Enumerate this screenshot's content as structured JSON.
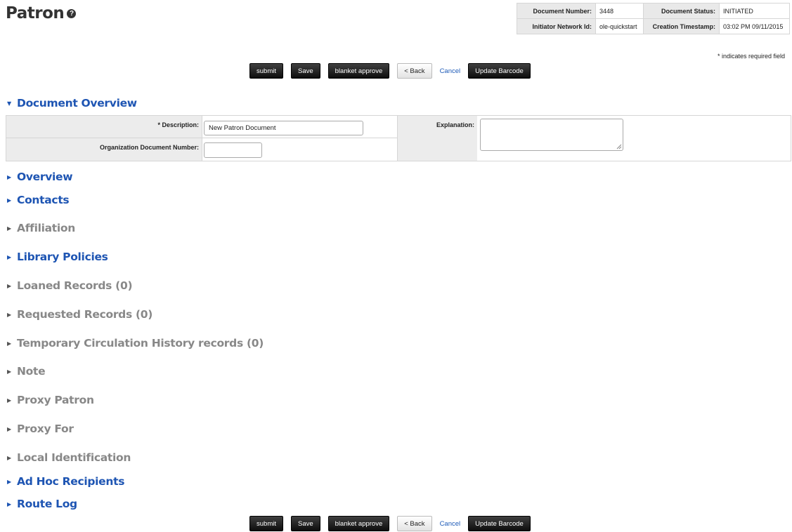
{
  "page": {
    "title": "Patron",
    "help_icon": "?"
  },
  "doc_info": {
    "number_label": "Document Number:",
    "number_value": "3448",
    "status_label": "Document Status:",
    "status_value": "INITIATED",
    "initiator_label": "Initiator Network Id:",
    "initiator_value": "ole-quickstart",
    "timestamp_label": "Creation Timestamp:",
    "timestamp_value": "03:02 PM 09/11/2015"
  },
  "required_note": "* indicates required field",
  "buttons": {
    "submit": "submit",
    "save": "Save",
    "blanket_approve": "blanket approve",
    "back": "< Back",
    "cancel": "Cancel",
    "update_barcode": "Update Barcode"
  },
  "doc_overview": {
    "title": "Document Overview",
    "description_label": "* Description:",
    "description_value": "New Patron Document",
    "org_doc_number_label": "Organization Document Number:",
    "org_doc_number_value": "",
    "explanation_label": "Explanation:",
    "explanation_value": ""
  },
  "sections": [
    {
      "label": "Overview",
      "state": "active"
    },
    {
      "label": "Contacts",
      "state": "active"
    },
    {
      "label": "Affiliation",
      "state": "disabled"
    },
    {
      "label": "Library Policies",
      "state": "active"
    },
    {
      "label": "Loaned Records (0)",
      "state": "disabled"
    },
    {
      "label": "Requested Records (0)",
      "state": "disabled"
    },
    {
      "label": "Temporary Circulation History records (0)",
      "state": "disabled"
    },
    {
      "label": "Note",
      "state": "disabled"
    },
    {
      "label": "Proxy Patron",
      "state": "disabled"
    },
    {
      "label": "Proxy For",
      "state": "disabled"
    },
    {
      "label": "Local Identification",
      "state": "disabled"
    },
    {
      "label": "Ad Hoc Recipients",
      "state": "active"
    },
    {
      "label": "Route Log",
      "state": "active"
    }
  ],
  "colors": {
    "link_blue": "#1e55b3",
    "disabled_gray": "#888888",
    "button_dark": "#1a1a1a"
  },
  "icons": {
    "expanded": "triangle-down-icon",
    "collapsed": "triangle-right-icon",
    "help": "help-icon"
  }
}
